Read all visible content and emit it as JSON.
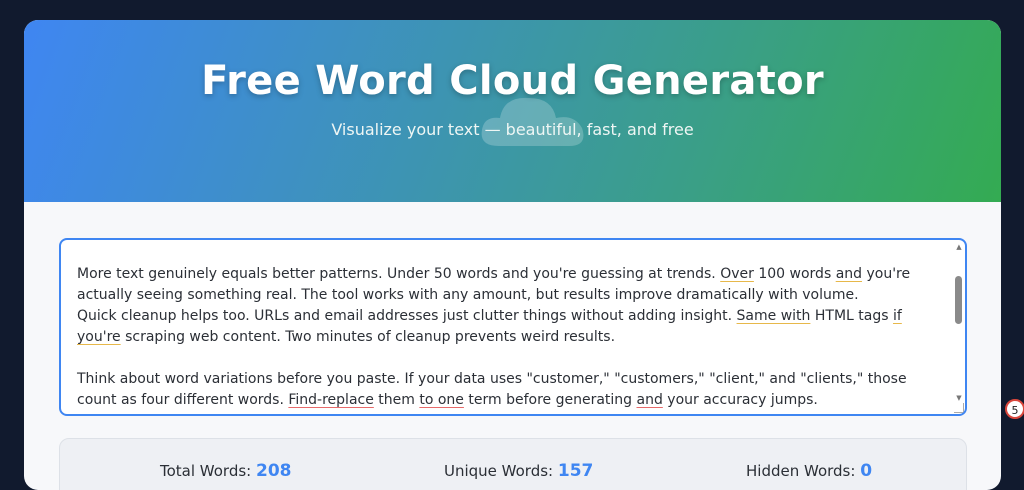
{
  "hero": {
    "title": "Free Word Cloud Generator",
    "subtitle": "Visualize your text — beautiful, fast, and free",
    "background_icon": "cloud-icon"
  },
  "input": {
    "paragraph1_a": "More text genuinely equals better patterns. Under 50 words and you're guessing at trends. ",
    "paragraph1_b": "Over",
    "paragraph1_c": " 100 words ",
    "paragraph1_d": "and",
    "paragraph1_e": " you're actually seeing something real. The tool works with any amount, but results improve dramatically with volume.",
    "paragraph2_a": "Quick cleanup helps too. URLs and email addresses just clutter things without adding insight. ",
    "paragraph2_b": "Same with",
    "paragraph2_c": " HTML tags ",
    "paragraph2_d": "if you're",
    "paragraph2_e": " scraping web content. Two minutes of cleanup prevents weird results.",
    "paragraph3_a": "Think about word variations before you paste. If your data uses \"customer,\" \"customers,\" \"client,\" and \"clients,\" those count as four different words. ",
    "paragraph3_b": "Find-replace",
    "paragraph3_c": " them ",
    "paragraph3_d": "to one",
    "paragraph3_e": " term before generating ",
    "paragraph3_f": "and",
    "paragraph3_g": " your accuracy jumps."
  },
  "stats": {
    "total_label": "Total Words: ",
    "total_value": "208",
    "unique_label": "Unique Words: ",
    "unique_value": "157",
    "hidden_label": "Hidden Words: ",
    "hidden_value": "0"
  },
  "side_badge": "5",
  "colors": {
    "accent": "#3f86f2",
    "gradient_start": "#3f86f2",
    "gradient_end": "#34ab52",
    "page_bg": "#111a2e"
  }
}
